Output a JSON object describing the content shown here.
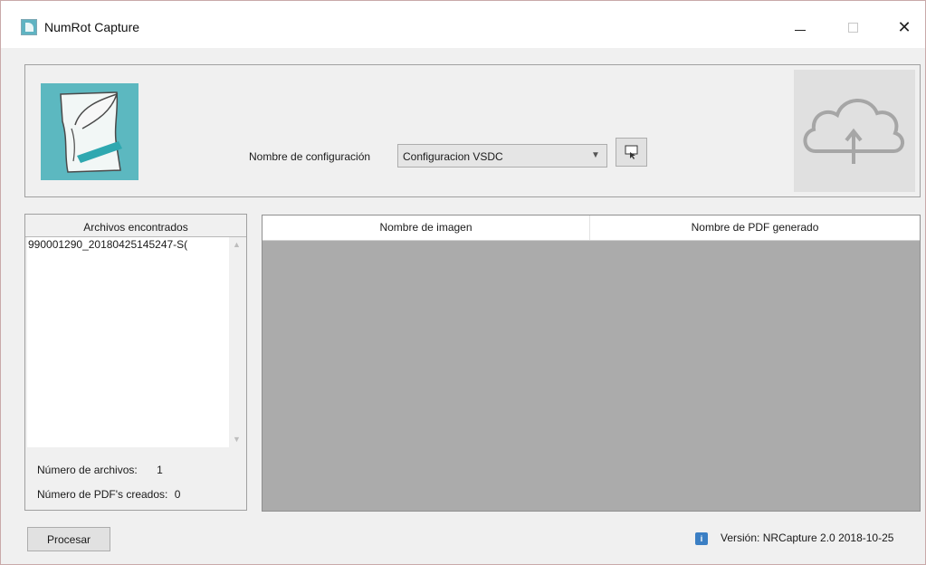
{
  "window": {
    "title": "NumRot Capture",
    "close_glyph": "✕"
  },
  "header": {
    "config_label": "Nombre de configuración",
    "config_value": "Configuracion VSDC",
    "config_button_icon": "screen-capture-icon",
    "cloud_icon": "cloud-upload-icon"
  },
  "files": {
    "title": "Archivos encontrados",
    "items": [
      "990001290_20180425145247-S("
    ],
    "count_label": "Número de archivos:",
    "count_value": "1",
    "pdf_label": "Número de PDF's creados:",
    "pdf_value": "0"
  },
  "grid": {
    "columns": [
      "Nombre de imagen",
      "Nombre de PDF generado"
    ]
  },
  "footer": {
    "process_label": "Procesar",
    "version_text": "Versión: NRCapture 2.0 2018-10-25"
  },
  "colors": {
    "logo_teal": "#5cb8c0",
    "grid_background": "#ababab",
    "info_blue": "#3b7fc4"
  }
}
